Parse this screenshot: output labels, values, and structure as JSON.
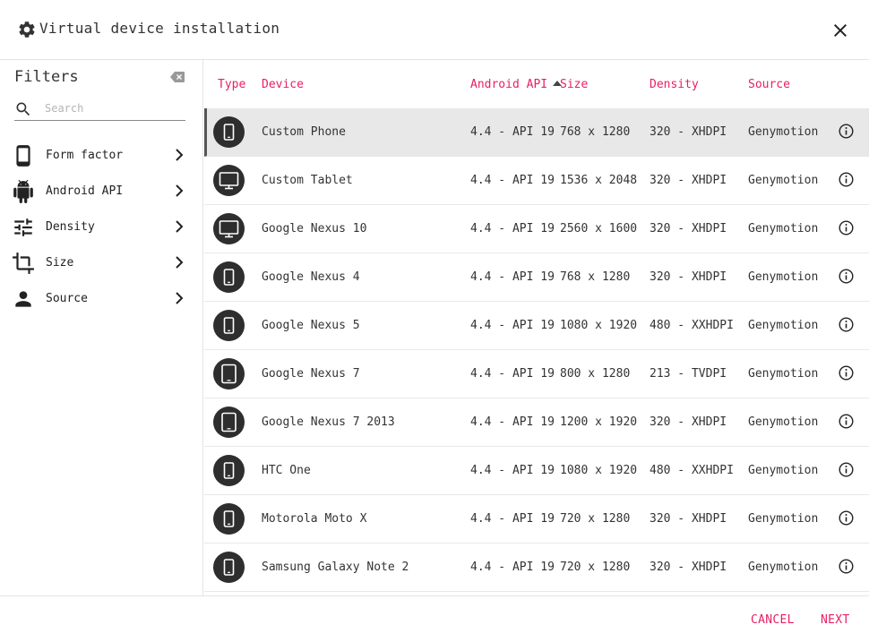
{
  "window": {
    "title": "Virtual device installation",
    "title_icon": "gear-icon",
    "close_icon": "close-icon"
  },
  "filters": {
    "heading": "Filters",
    "clear_icon": "backspace-icon",
    "search": {
      "placeholder": "Search",
      "value": ""
    },
    "items": [
      {
        "label": "Form factor",
        "icon": "phone-icon"
      },
      {
        "label": "Android API",
        "icon": "android-icon"
      },
      {
        "label": "Density",
        "icon": "sliders-icon"
      },
      {
        "label": "Size",
        "icon": "crop-icon"
      },
      {
        "label": "Source",
        "icon": "person-icon"
      }
    ]
  },
  "table": {
    "columns": {
      "type": "Type",
      "device": "Device",
      "api": "Android API",
      "size": "Size",
      "density": "Density",
      "source": "Source"
    },
    "sorted_by": "Android API",
    "sort_direction": "ascending",
    "rows": [
      {
        "type": "phone",
        "device": "Custom Phone",
        "api": "4.4 - API 19",
        "size": "768 x 1280",
        "density": "320 - XHDPI",
        "source": "Genymotion",
        "selected": true
      },
      {
        "type": "monitor",
        "device": "Custom Tablet",
        "api": "4.4 - API 19",
        "size": "1536 x 2048",
        "density": "320 - XHDPI",
        "source": "Genymotion",
        "selected": false
      },
      {
        "type": "monitor",
        "device": "Google Nexus 10",
        "api": "4.4 - API 19",
        "size": "2560 x 1600",
        "density": "320 - XHDPI",
        "source": "Genymotion",
        "selected": false
      },
      {
        "type": "phone",
        "device": "Google Nexus 4",
        "api": "4.4 - API 19",
        "size": "768 x 1280",
        "density": "320 - XHDPI",
        "source": "Genymotion",
        "selected": false
      },
      {
        "type": "phone",
        "device": "Google Nexus 5",
        "api": "4.4 - API 19",
        "size": "1080 x 1920",
        "density": "480 - XXHDPI",
        "source": "Genymotion",
        "selected": false
      },
      {
        "type": "tablet",
        "device": "Google Nexus 7",
        "api": "4.4 - API 19",
        "size": "800 x 1280",
        "density": "213 - TVDPI",
        "source": "Genymotion",
        "selected": false
      },
      {
        "type": "tablet",
        "device": "Google Nexus 7 2013",
        "api": "4.4 - API 19",
        "size": "1200 x 1920",
        "density": "320 - XHDPI",
        "source": "Genymotion",
        "selected": false
      },
      {
        "type": "phone",
        "device": "HTC One",
        "api": "4.4 - API 19",
        "size": "1080 x 1920",
        "density": "480 - XXHDPI",
        "source": "Genymotion",
        "selected": false
      },
      {
        "type": "phone",
        "device": "Motorola Moto X",
        "api": "4.4 - API 19",
        "size": "720 x 1280",
        "density": "320 - XHDPI",
        "source": "Genymotion",
        "selected": false
      },
      {
        "type": "phone",
        "device": "Samsung Galaxy Note 2",
        "api": "4.4 - API 19",
        "size": "720 x 1280",
        "density": "320 - XHDPI",
        "source": "Genymotion",
        "selected": false
      }
    ]
  },
  "footer": {
    "cancel_label": "CANCEL",
    "next_label": "NEXT"
  },
  "colors": {
    "accent": "#e91e63",
    "icon_bg": "#2e2e2e",
    "selected_row": "#e8e8e8"
  }
}
